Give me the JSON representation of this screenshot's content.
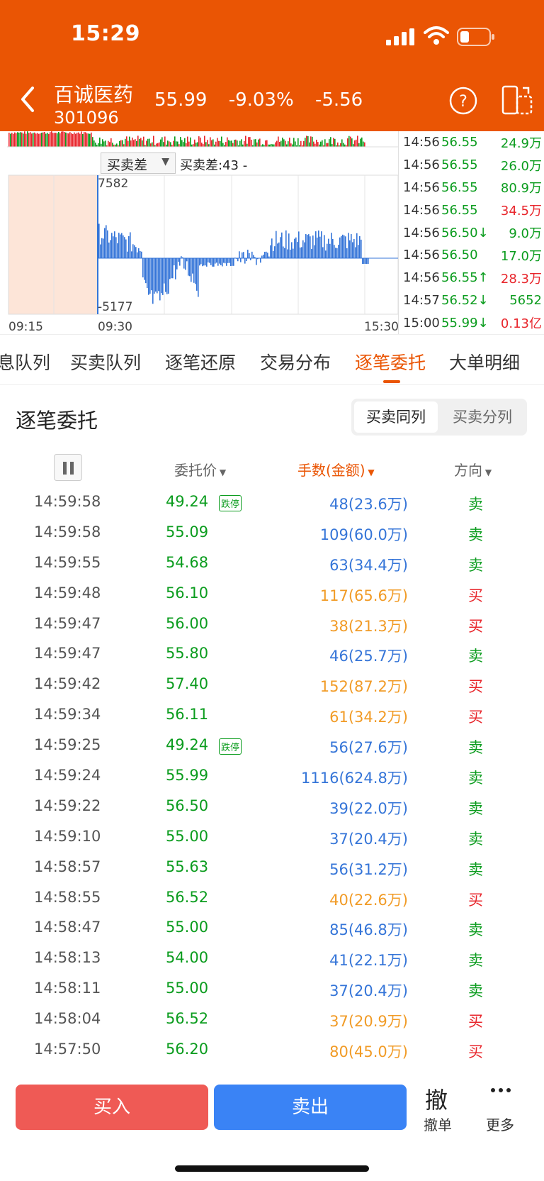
{
  "status_bar": {
    "time": "15:29"
  },
  "header": {
    "name": "百诚医药",
    "code": "301096",
    "price": "55.99",
    "pct": "-9.03%",
    "change": "-5.56",
    "colors": {
      "brand": "#ea5504"
    }
  },
  "chart": {
    "indicator": "买卖差",
    "indicator_value": "买卖差:43 -",
    "ymax": "7582",
    "ymin": "-5177",
    "x_start": "09:15",
    "x_mid": "09:30",
    "x_end": "15:30"
  },
  "ticks": [
    {
      "time": "14:56",
      "price": "56.55",
      "vol": "24.9万",
      "side": "sell"
    },
    {
      "time": "14:56",
      "price": "56.55",
      "vol": "26.0万",
      "side": "sell"
    },
    {
      "time": "14:56",
      "price": "56.55",
      "vol": "80.9万",
      "side": "sell"
    },
    {
      "time": "14:56",
      "price": "56.55",
      "vol": "34.5万",
      "side": "buy"
    },
    {
      "time": "14:56",
      "price": "56.50↓",
      "vol": "9.0万",
      "side": "sell"
    },
    {
      "time": "14:56",
      "price": "56.50",
      "vol": "17.0万",
      "side": "sell"
    },
    {
      "time": "14:56",
      "price": "56.55↑",
      "vol": "28.3万",
      "side": "buy"
    },
    {
      "time": "14:57",
      "price": "56.52↓",
      "vol": "5652",
      "side": "sell"
    },
    {
      "time": "15:00",
      "price": "55.99↓",
      "vol": "0.13亿",
      "side": "buy"
    }
  ],
  "tabs": [
    "息队列",
    "买卖队列",
    "逐笔还原",
    "交易分布",
    "逐笔委托",
    "大单明细"
  ],
  "section": {
    "title": "逐笔委托",
    "seg_on": "买卖同列",
    "seg_off": "买卖分列"
  },
  "columns": {
    "price": "委托价",
    "amount": "手数(金额)",
    "direction": "方向"
  },
  "limit_badge": "跌停",
  "orders": [
    {
      "time": "14:59:58",
      "price": "49.24",
      "limit": true,
      "amount": "48(23.6万)",
      "dir": "卖",
      "side": "sell"
    },
    {
      "time": "14:59:58",
      "price": "55.09",
      "limit": false,
      "amount": "109(60.0万)",
      "dir": "卖",
      "side": "sell"
    },
    {
      "time": "14:59:55",
      "price": "54.68",
      "limit": false,
      "amount": "63(34.4万)",
      "dir": "卖",
      "side": "sell"
    },
    {
      "time": "14:59:48",
      "price": "56.10",
      "limit": false,
      "amount": "117(65.6万)",
      "dir": "买",
      "side": "buy"
    },
    {
      "time": "14:59:47",
      "price": "56.00",
      "limit": false,
      "amount": "38(21.3万)",
      "dir": "买",
      "side": "buy"
    },
    {
      "time": "14:59:47",
      "price": "55.80",
      "limit": false,
      "amount": "46(25.7万)",
      "dir": "卖",
      "side": "sell"
    },
    {
      "time": "14:59:42",
      "price": "57.40",
      "limit": false,
      "amount": "152(87.2万)",
      "dir": "买",
      "side": "buy"
    },
    {
      "time": "14:59:34",
      "price": "56.11",
      "limit": false,
      "amount": "61(34.2万)",
      "dir": "买",
      "side": "buy"
    },
    {
      "time": "14:59:25",
      "price": "49.24",
      "limit": true,
      "amount": "56(27.6万)",
      "dir": "卖",
      "side": "sell"
    },
    {
      "time": "14:59:24",
      "price": "55.99",
      "limit": false,
      "amount": "1116(624.8万)",
      "dir": "卖",
      "side": "sell"
    },
    {
      "time": "14:59:22",
      "price": "56.50",
      "limit": false,
      "amount": "39(22.0万)",
      "dir": "卖",
      "side": "sell"
    },
    {
      "time": "14:59:10",
      "price": "55.00",
      "limit": false,
      "amount": "37(20.4万)",
      "dir": "卖",
      "side": "sell"
    },
    {
      "time": "14:58:57",
      "price": "55.63",
      "limit": false,
      "amount": "56(31.2万)",
      "dir": "卖",
      "side": "sell"
    },
    {
      "time": "14:58:55",
      "price": "56.52",
      "limit": false,
      "amount": "40(22.6万)",
      "dir": "买",
      "side": "buy"
    },
    {
      "time": "14:58:47",
      "price": "55.00",
      "limit": false,
      "amount": "85(46.8万)",
      "dir": "卖",
      "side": "sell"
    },
    {
      "time": "14:58:13",
      "price": "54.00",
      "limit": false,
      "amount": "41(22.1万)",
      "dir": "卖",
      "side": "sell"
    },
    {
      "time": "14:58:11",
      "price": "55.00",
      "limit": false,
      "amount": "37(20.4万)",
      "dir": "卖",
      "side": "sell"
    },
    {
      "time": "14:58:04",
      "price": "56.52",
      "limit": false,
      "amount": "37(20.9万)",
      "dir": "买",
      "side": "buy"
    },
    {
      "time": "14:57:50",
      "price": "56.20",
      "limit": false,
      "amount": "80(45.0万)",
      "dir": "买",
      "side": "buy"
    }
  ],
  "bottom": {
    "buy": "买入",
    "sell": "卖出",
    "cancel_icon": "撤",
    "cancel_label": "撤单",
    "more_label": "更多"
  }
}
